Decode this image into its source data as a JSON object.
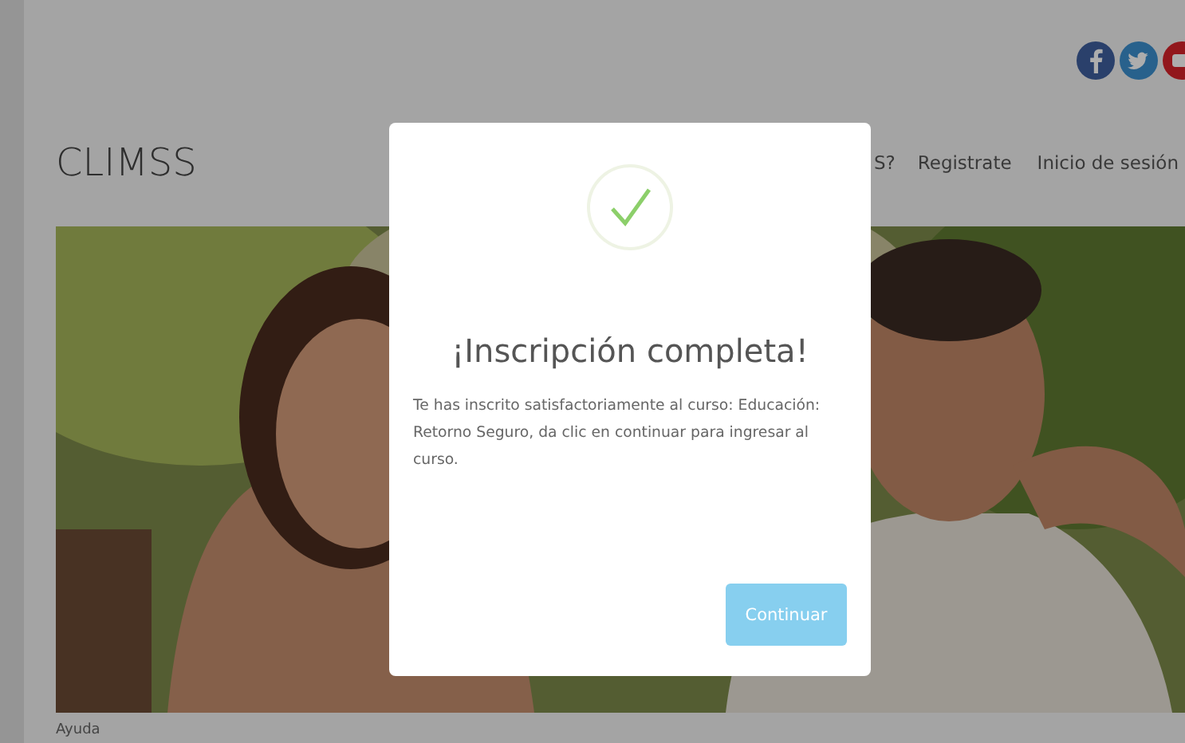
{
  "header": {
    "social": [
      {
        "kind": "facebook"
      },
      {
        "kind": "twitter"
      },
      {
        "kind": "youtube"
      }
    ],
    "logo": "CLIMSS",
    "nav": [
      "S?",
      "Registrate",
      "Inicio de sesión"
    ]
  },
  "footer_link": "Ayuda",
  "modal": {
    "title": "¡Inscripción completa!",
    "message": "Te has inscrito satisfactoriamente al curso: Educación: Retorno Seguro, da clic en continuar para ingresar al curso.",
    "button": "Continuar"
  }
}
